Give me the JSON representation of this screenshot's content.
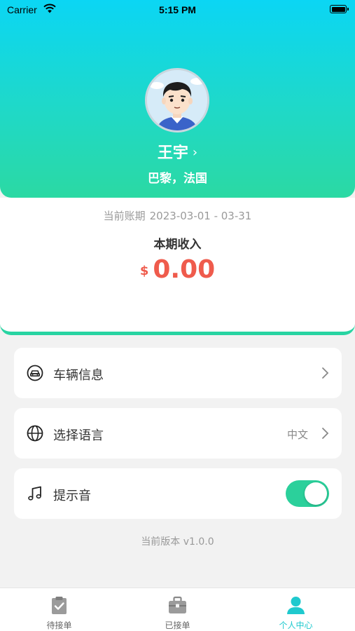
{
  "status_bar": {
    "carrier": "Carrier",
    "time": "5:15 PM",
    "wifi_icon": "wifi-icon",
    "battery_icon": "battery-icon"
  },
  "profile": {
    "name": "王宇",
    "location": "巴黎，法国",
    "avatar_icon": "avatar-cartoon-man"
  },
  "income": {
    "period_label": "当前账期",
    "period_range": "2023-03-01 - 03-31",
    "label": "本期收入",
    "currency": "$",
    "amount": "0.00"
  },
  "settings": [
    {
      "icon": "car-icon",
      "label": "车辆信息",
      "value": ""
    },
    {
      "icon": "globe-icon",
      "label": "选择语言",
      "value": "中文"
    },
    {
      "icon": "music-note-icon",
      "label": "提示音",
      "toggle_on": true
    }
  ],
  "version": "当前版本 v1.0.0",
  "tabs": [
    {
      "icon": "clipboard-check-icon",
      "label": "待接单",
      "active": false
    },
    {
      "icon": "briefcase-icon",
      "label": "已接单",
      "active": false
    },
    {
      "icon": "person-icon",
      "label": "个人中心",
      "active": true
    }
  ],
  "colors": {
    "header_gradient_top": "#0bd6f4",
    "header_gradient_bottom": "#2bd9a3",
    "amount": "#ef5b4c",
    "toggle_on": "#2bd09b",
    "tab_active": "#1fc9ce",
    "tab_inactive": "#999999"
  }
}
